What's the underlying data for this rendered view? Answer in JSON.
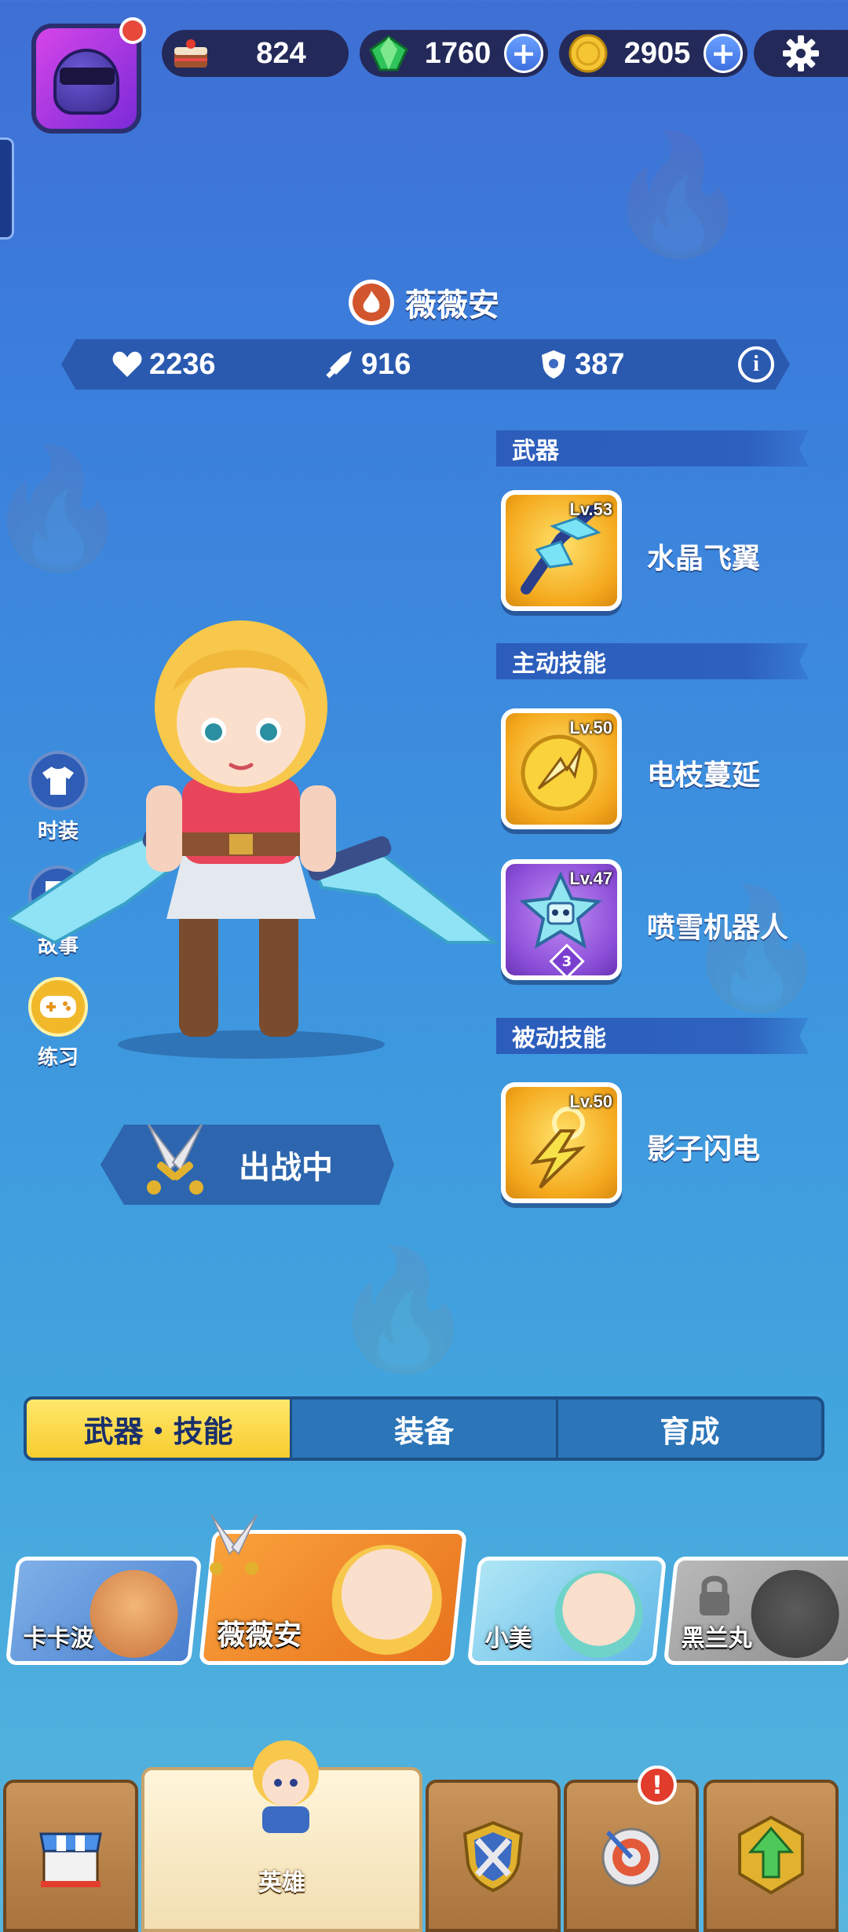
{
  "resources": {
    "cake": {
      "value": "824",
      "icon": "cake-icon"
    },
    "gems": {
      "value": "1760",
      "icon": "gem-icon"
    },
    "coins": {
      "value": "2905",
      "icon": "coin-icon"
    }
  },
  "hero": {
    "name": "薇薇安",
    "stats": {
      "hp": "2236",
      "attack": "916",
      "defense": "387"
    }
  },
  "sections": {
    "weapon": "武器",
    "active_skills": "主动技能",
    "passive_skills": "被动技能"
  },
  "weapon": {
    "level": "Lv.53",
    "name": "水晶飞翼"
  },
  "active_skills": [
    {
      "level": "Lv.50",
      "name": "电枝蔓延"
    },
    {
      "level": "Lv.47",
      "name": "喷雪机器人",
      "rank": "3"
    }
  ],
  "passive_skills": [
    {
      "level": "Lv.50",
      "name": "影子闪电"
    }
  ],
  "side_buttons": [
    {
      "label": "时装",
      "icon": "shirt-icon"
    },
    {
      "label": "故事",
      "icon": "story-icon"
    },
    {
      "label": "练习",
      "icon": "gamepad-icon"
    }
  ],
  "battle_status": "出战中",
  "tabs": [
    {
      "label": "武器・技能",
      "active": true
    },
    {
      "label": "装备",
      "active": false
    },
    {
      "label": "育成",
      "active": false
    }
  ],
  "hero_roster": [
    {
      "name": "卡卡波",
      "locked": false
    },
    {
      "name": "薇薇安",
      "locked": false,
      "selected": true
    },
    {
      "name": "小美",
      "locked": false
    },
    {
      "name": "黑兰丸",
      "locked": true
    }
  ],
  "bottom_nav": [
    {
      "label": "",
      "icon": "shop-icon"
    },
    {
      "label": "英雄",
      "icon": "hero-icon",
      "active": true
    },
    {
      "label": "",
      "icon": "battle-icon"
    },
    {
      "label": "",
      "icon": "target-icon",
      "alert": "!"
    },
    {
      "label": "",
      "icon": "upgrade-icon"
    }
  ],
  "colors": {
    "background_top": "#3f6fd4",
    "background_bottom": "#58b6de",
    "active_tab": "#f8cc2f",
    "panel_dark": "#232a5a"
  }
}
